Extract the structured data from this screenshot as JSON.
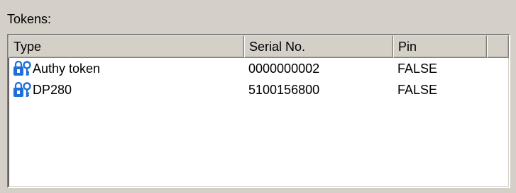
{
  "tokens_section": {
    "label": "Tokens:"
  },
  "table": {
    "columns": [
      "Type",
      "Serial No.",
      "Pin"
    ],
    "rows": [
      {
        "type": "Authy token",
        "serial": "0000000002",
        "pin": "FALSE",
        "icon": "token-lock-icon"
      },
      {
        "type": "DP280",
        "serial": "5100156800",
        "pin": "FALSE",
        "icon": "token-lock-icon"
      }
    ]
  },
  "colors": {
    "icon_blue": "#1e6fd9",
    "window_bg": "#d4d0c8",
    "list_bg": "#ffffff"
  }
}
